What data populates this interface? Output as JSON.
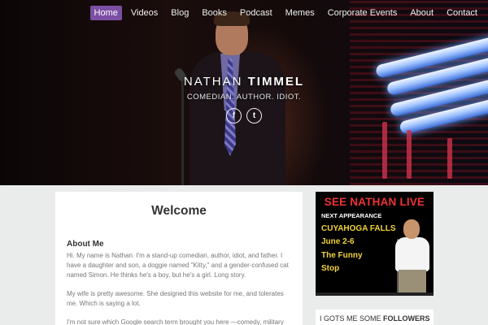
{
  "nav": {
    "items": [
      {
        "label": "Home",
        "active": true
      },
      {
        "label": "Videos",
        "active": false
      },
      {
        "label": "Blog",
        "active": false
      },
      {
        "label": "Books",
        "active": false
      },
      {
        "label": "Podcast",
        "active": false
      },
      {
        "label": "Memes",
        "active": false
      },
      {
        "label": "Corporate Events",
        "active": false
      },
      {
        "label": "About",
        "active": false
      },
      {
        "label": "Contact",
        "active": false
      }
    ],
    "active_color": "#7b4fa3"
  },
  "hero": {
    "name_first": "NATHAN",
    "name_last": "TIMMEL",
    "tagline": "COMEDIAN. AUTHOR. IDIOT.",
    "social": [
      {
        "icon": "facebook-icon",
        "glyph": "f"
      },
      {
        "icon": "twitter-icon",
        "glyph": "t"
      }
    ]
  },
  "main": {
    "title": "Welcome",
    "about_heading": "About Me",
    "paragraphs": [
      "Hi. My name is Nathan. I'm a stand-up comedian, author, idiot, and father. I have a daughter and son, a doggie named \"Kitty,\" and a gender-confused cat named Simon. He thinks he's a boy, but he's a girl. Long story.",
      "My wife is pretty awesome. She designed this website for me, and tolerates me. Which is saying a lot.",
      "I'm not sure which Google search term brought you here —comedy, military comedian, \"tantric sex video\" (Google Analytics tells me that phrase actually"
    ]
  },
  "sidebar": {
    "ad": {
      "title": "SEE NATHAN LIVE",
      "subtitle": "NEXT APPEARANCE",
      "lines": [
        "CUYAHOGA FALLS",
        "June 2-6",
        "The Funny",
        "Stop"
      ]
    },
    "widget": {
      "text_normal": "I GOTS ME SOME ",
      "text_bold": "FOLLOWERS"
    }
  }
}
